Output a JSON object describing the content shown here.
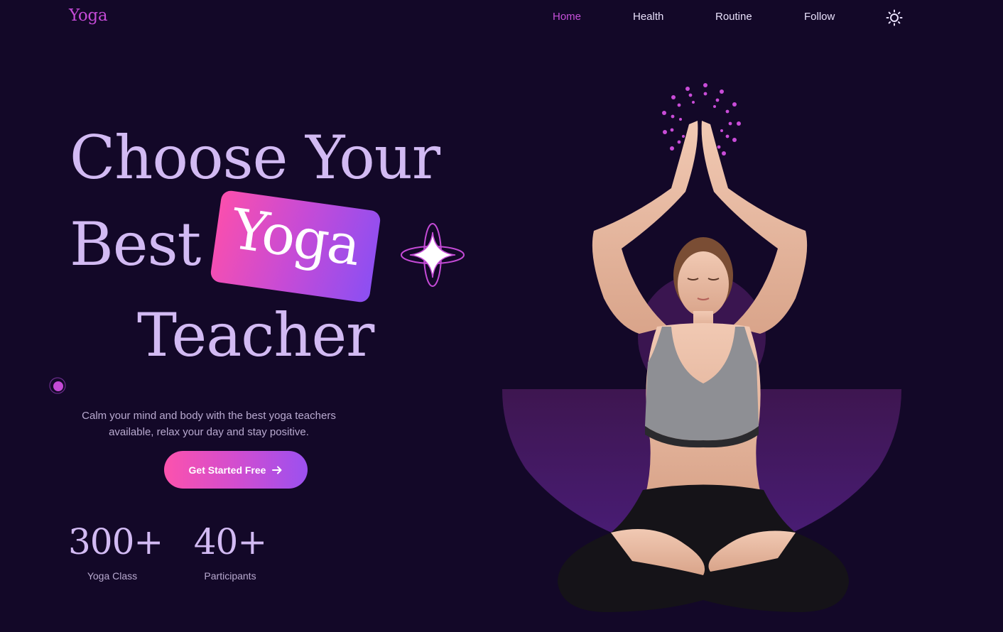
{
  "header": {
    "logo": "Yoga",
    "nav": [
      {
        "label": "Home",
        "active": true
      },
      {
        "label": "Health",
        "active": false
      },
      {
        "label": "Routine",
        "active": false
      },
      {
        "label": "Follow",
        "active": false
      }
    ],
    "theme_icon": "sun-icon"
  },
  "hero": {
    "line1": "Choose Your",
    "line2": "Best",
    "highlight": "Yoga",
    "line3": "Teacher",
    "subtitle": "Calm your mind and body with the best yoga teachers available, relax your day and stay positive.",
    "cta": {
      "label": "Get Started Free",
      "icon": "arrow-right-icon"
    }
  },
  "stats": [
    {
      "value": "300+",
      "label": "Yoga Class"
    },
    {
      "value": "40+",
      "label": "Participants"
    }
  ],
  "colors": {
    "background": "#130828",
    "heading": "#d2baf3",
    "accent_pink": "#fb4fad",
    "accent_purple": "#8b4ff3",
    "nav_active": "#c650d9"
  }
}
